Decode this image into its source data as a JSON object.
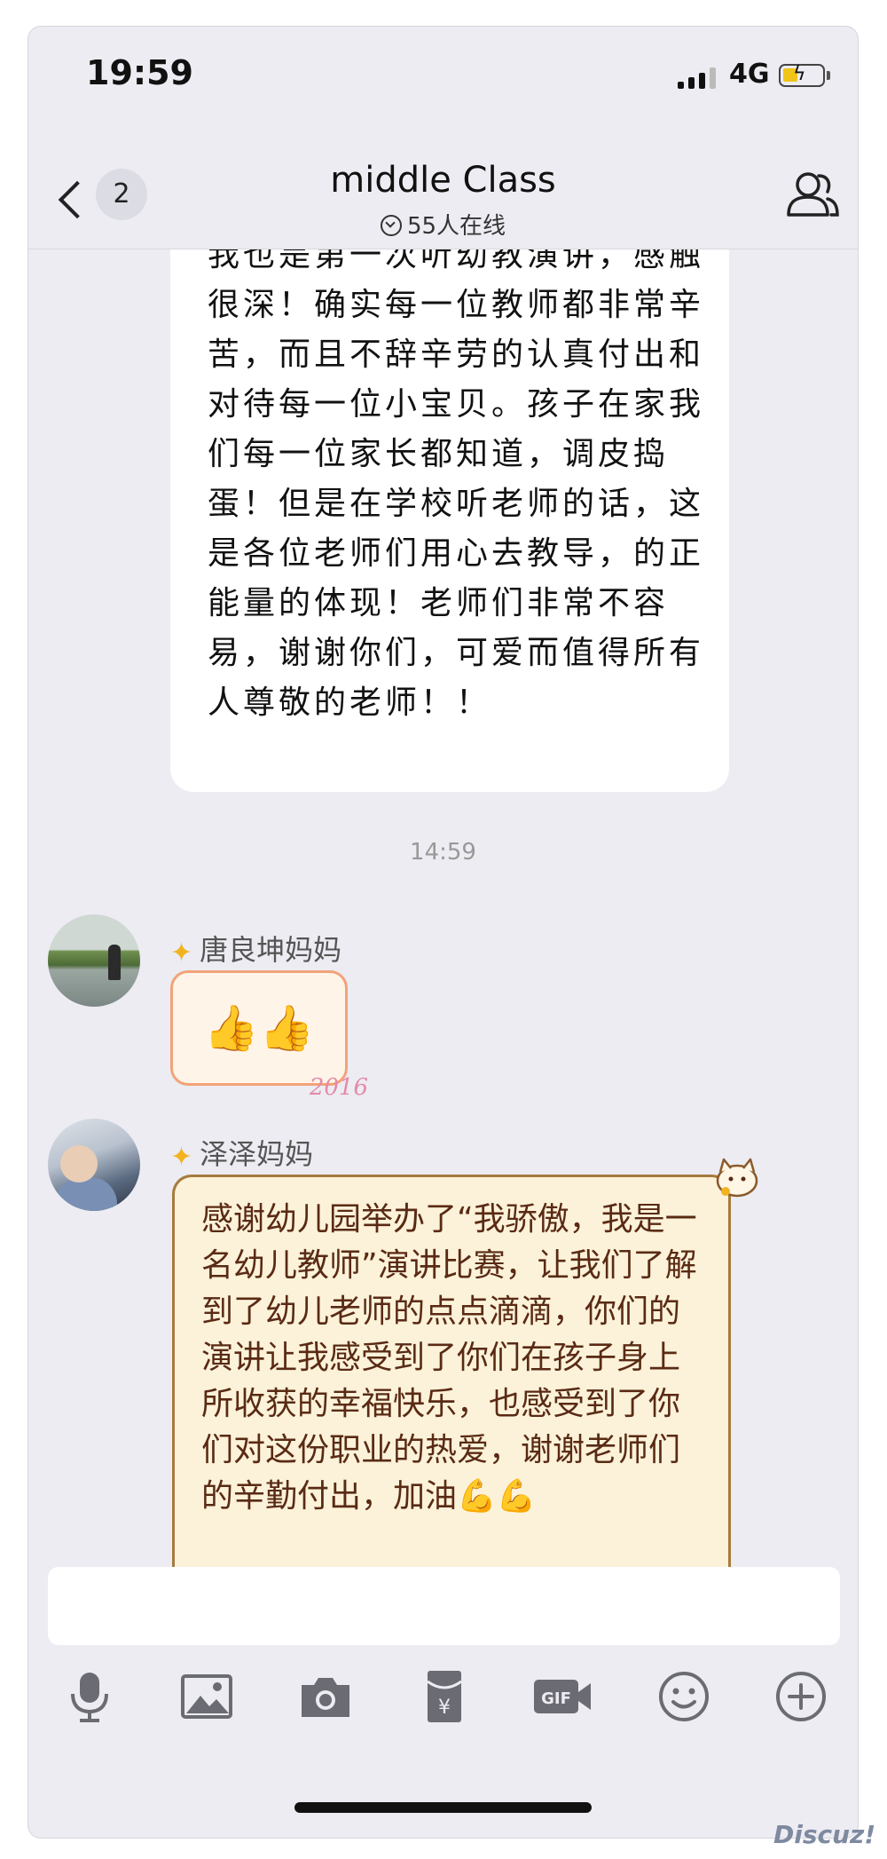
{
  "status_bar": {
    "time": "19:59",
    "network": "4G"
  },
  "header": {
    "back_count": "2",
    "title": "middle Class",
    "online": "55人在线"
  },
  "messages": [
    {
      "kind": "text",
      "text": "我也是第一次听幼教演讲，感触很深！确实每一位教师都非常辛苦，而且不辞辛劳的认真付出和对待每一位小宝贝。孩子在家我们每一位家长都知道，调皮捣蛋！但是在学校听老师的话，这是各位老师们用心去教导，的正能量的体现！老师们非常不容易，谢谢你们，可爱而值得所有人尊敬的老师！！"
    },
    {
      "kind": "timestamp",
      "text": "14:59"
    },
    {
      "kind": "sticker",
      "sender": "唐良坤妈妈",
      "sticker_text": "👍👍",
      "sticker_year": "2016"
    },
    {
      "kind": "text",
      "sender": "泽泽妈妈",
      "text": "感谢幼儿园举办了“我骄傲，我是一名幼儿教师”演讲比赛，让我们了解到了幼儿老师的点点滴滴，你们的演讲让我感受到了你们在孩子身上所收获的幸福快乐，也感受到了你们对这份职业的热爱，谢谢老师们的辛勤付出，加油💪💪"
    }
  ],
  "input": {
    "placeholder": ""
  },
  "toolbar": {
    "icons": [
      "microphone-icon",
      "image-icon",
      "camera-icon",
      "red-packet-icon",
      "gif-icon",
      "emoji-icon",
      "plus-icon"
    ],
    "gif_label": "GIF",
    "yuan_label": "¥"
  },
  "colors": {
    "background": "#ececf2",
    "bubble_cream": "#fbf2d9",
    "bubble_cream_text": "#5a2a14",
    "star": "#f2b321",
    "battery": "#f0c419"
  },
  "watermark": "Discuz!"
}
